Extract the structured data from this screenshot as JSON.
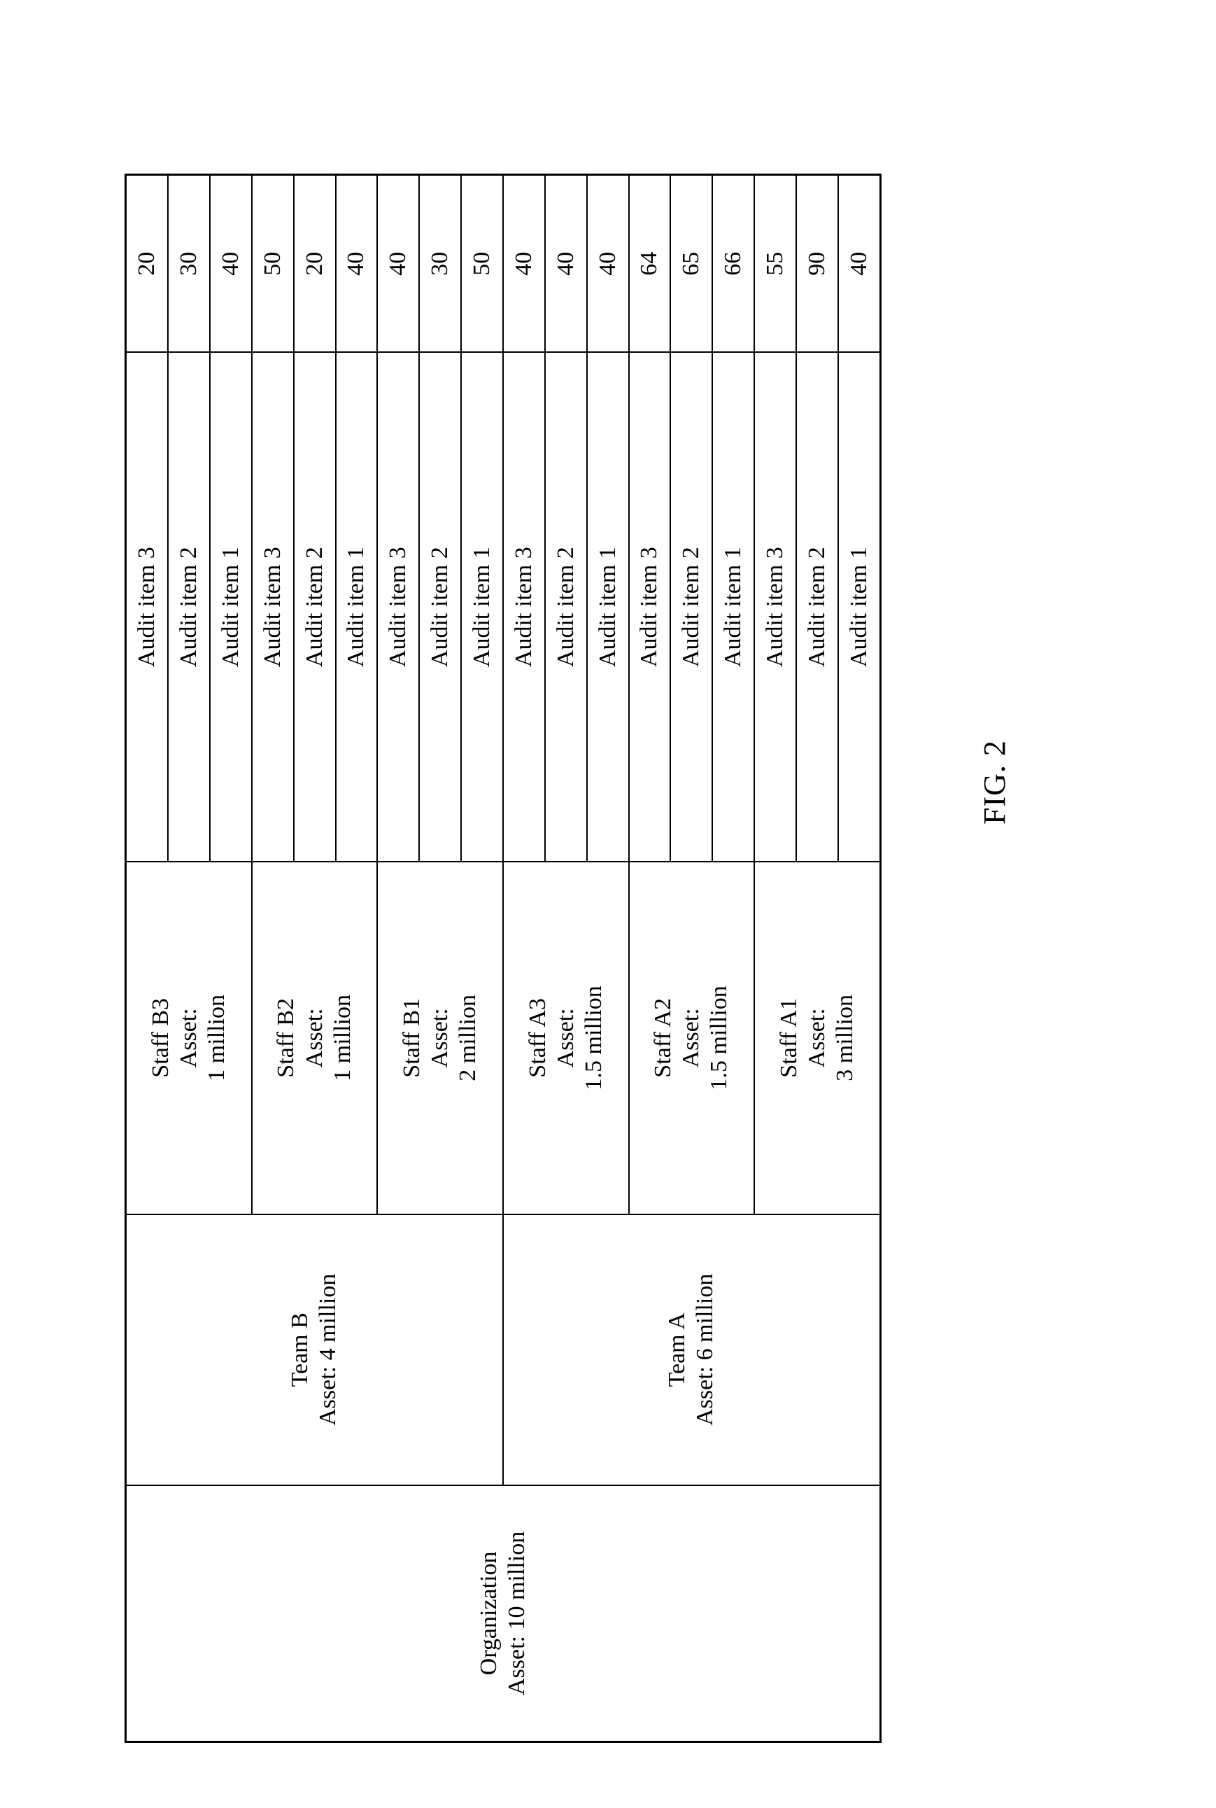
{
  "figure": {
    "caption": "FIG. 2"
  },
  "table": {
    "organization": {
      "name": "Organization",
      "asset": "Asset: 10 million",
      "label": "Organization\nAsset: 10 million"
    },
    "teams": [
      {
        "name": "Team B",
        "asset": "Asset: 4 million",
        "label": "Team B\nAsset: 4 million",
        "staff": [
          {
            "name": "Staff B3",
            "asset_line1": "Asset:",
            "asset_line2": "1 million",
            "label": "Staff B3\nAsset:\n1 million",
            "items": [
              {
                "item": "Audit item 3",
                "score": "20"
              },
              {
                "item": "Audit item 2",
                "score": "30"
              },
              {
                "item": "Audit item 1",
                "score": "40"
              }
            ]
          },
          {
            "name": "Staff B2",
            "asset_line1": "Asset:",
            "asset_line2": "1 million",
            "label": "Staff B2\nAsset:\n1 million",
            "items": [
              {
                "item": "Audit item 3",
                "score": "50"
              },
              {
                "item": "Audit item 2",
                "score": "20"
              },
              {
                "item": "Audit item 1",
                "score": "40"
              }
            ]
          },
          {
            "name": "Staff B1",
            "asset_line1": "Asset:",
            "asset_line2": "2 million",
            "label": "Staff B1\nAsset:\n2 million",
            "items": [
              {
                "item": "Audit item 3",
                "score": "40"
              },
              {
                "item": "Audit item 2",
                "score": "30"
              },
              {
                "item": "Audit item 1",
                "score": "50"
              }
            ]
          }
        ]
      },
      {
        "name": "Team A",
        "asset": "Asset: 6 million",
        "label": "Team A\nAsset: 6 million",
        "staff": [
          {
            "name": "Staff A3",
            "asset_line1": "Asset:",
            "asset_line2": "1.5 million",
            "label": "Staff A3\nAsset:\n1.5 million",
            "items": [
              {
                "item": "Audit item 3",
                "score": "40"
              },
              {
                "item": "Audit item 2",
                "score": "40"
              },
              {
                "item": "Audit item 1",
                "score": "40"
              }
            ]
          },
          {
            "name": "Staff A2",
            "asset_line1": "Asset:",
            "asset_line2": "1.5 million",
            "label": "Staff A2\nAsset:\n1.5 million",
            "items": [
              {
                "item": "Audit item 3",
                "score": "64"
              },
              {
                "item": "Audit item 2",
                "score": "65"
              },
              {
                "item": "Audit item 1",
                "score": "66"
              }
            ]
          },
          {
            "name": "Staff A1",
            "asset_line1": "Asset:",
            "asset_line2": "3 million",
            "label": "Staff A1\nAsset:\n3 million",
            "items": [
              {
                "item": "Audit item 3",
                "score": "55"
              },
              {
                "item": "Audit item 2",
                "score": "90"
              },
              {
                "item": "Audit item 1",
                "score": "40"
              }
            ]
          }
        ]
      }
    ]
  },
  "rows": [
    {
      "org": "Organization\nAsset: 10 million",
      "team": "Team B\nAsset: 4 million",
      "staff": "Staff B3\nAsset:\n1 million",
      "item": "Audit item 3",
      "score": "20"
    },
    {
      "item": "Audit item 2",
      "score": "30"
    },
    {
      "item": "Audit item 1",
      "score": "40"
    },
    {
      "staff": "Staff B2\nAsset:\n1 million",
      "item": "Audit item 3",
      "score": "50"
    },
    {
      "item": "Audit item 2",
      "score": "20"
    },
    {
      "item": "Audit item 1",
      "score": "40"
    },
    {
      "staff": "Staff B1\nAsset:\n2 million",
      "item": "Audit item 3",
      "score": "40"
    },
    {
      "item": "Audit item 2",
      "score": "30"
    },
    {
      "item": "Audit item 1",
      "score": "50"
    },
    {
      "team": "Team A\nAsset: 6 million",
      "staff": "Staff A3\nAsset:\n1.5 million",
      "item": "Audit item 3",
      "score": "40"
    },
    {
      "item": "Audit item 2",
      "score": "40"
    },
    {
      "item": "Audit item 1",
      "score": "40"
    },
    {
      "staff": "Staff A2\nAsset:\n1.5 million",
      "item": "Audit item 3",
      "score": "64"
    },
    {
      "item": "Audit item 2",
      "score": "65"
    },
    {
      "item": "Audit item 1",
      "score": "66"
    },
    {
      "staff": "Staff A1\nAsset:\n3 million",
      "item": "Audit item 3",
      "score": "55"
    },
    {
      "item": "Audit item 2",
      "score": "90"
    },
    {
      "item": "Audit item 1",
      "score": "40"
    }
  ]
}
